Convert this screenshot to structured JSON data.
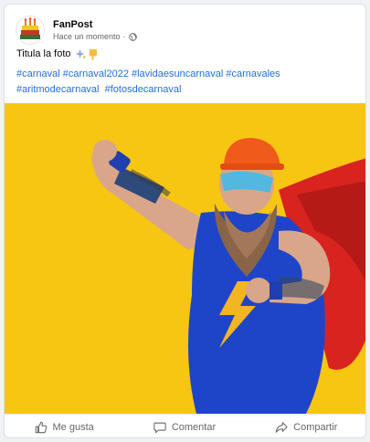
{
  "post": {
    "page_name": "FanPost",
    "timestamp": "Hace un momento",
    "separator": "·",
    "privacy_icon": "globe-icon",
    "caption": "Titula la foto",
    "caption_emojis": [
      "sparkles-icon",
      "pointing-down-hand-icon"
    ],
    "hashtags": [
      "#carnaval",
      "#carnaval2022",
      "#lavidaesuncarnaval",
      "#carnavales",
      "#aritmodecarnaval",
      "#fotosdecarnaval"
    ],
    "image_alt_icon": "costumed-superhero-photo"
  },
  "actions": {
    "like": "Me gusta",
    "comment": "Comentar",
    "share": "Compartir"
  },
  "colors": {
    "link": "#216fdb",
    "muted": "#65676b",
    "photo_background": "#f5c40e"
  }
}
